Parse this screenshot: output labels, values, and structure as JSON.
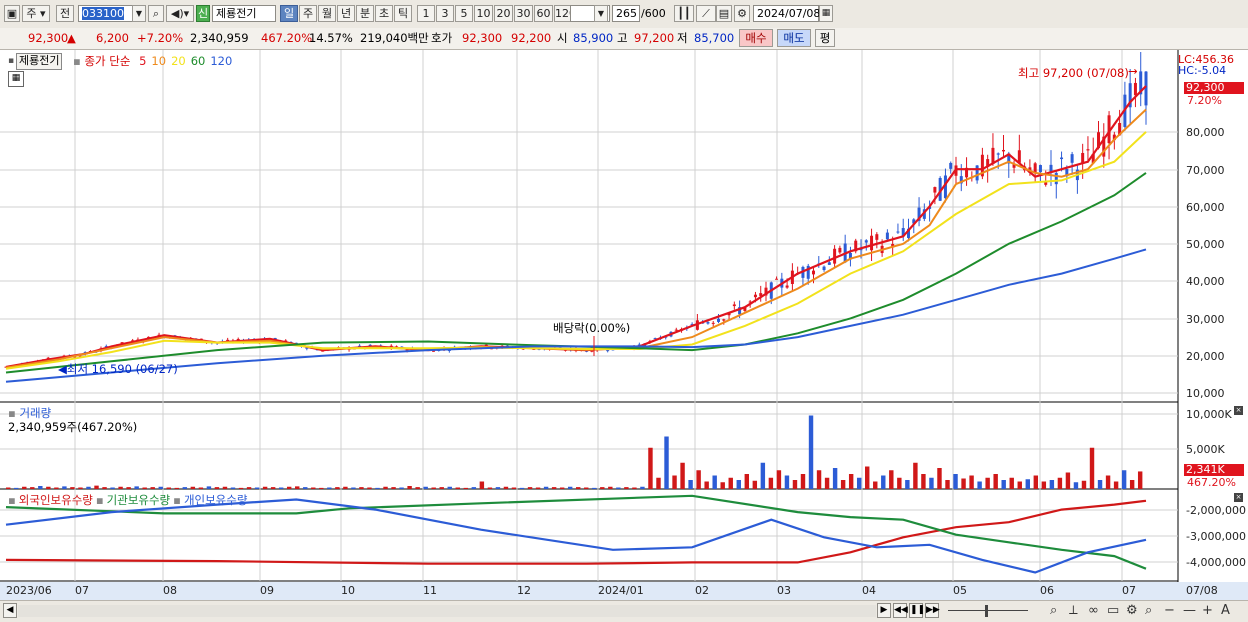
{
  "toolbar": {
    "market": "주",
    "prev": "전",
    "code": "033100",
    "new_badge": "신",
    "stock_name": "제룡전기",
    "periods": [
      "일",
      "주",
      "월",
      "년",
      "분",
      "초",
      "틱"
    ],
    "period_selected": "일",
    "intervals": [
      "1",
      "3",
      "5",
      "10",
      "20",
      "30",
      "60",
      "120"
    ],
    "count": "265",
    "count_total": "/600",
    "date": "2024/07/08"
  },
  "quote": {
    "price": "92,300",
    "change_arrow": "▲",
    "change": "6,200",
    "change_pct": "+7.20%",
    "volume": "2,340,959",
    "vol_ratio": "467.20%",
    "turnover": "14.57%",
    "amount": "219,040백만",
    "bid_label": "호가",
    "ask": "92,300",
    "bid": "92,200",
    "open_label": "시",
    "open": "85,900",
    "high_label": "고",
    "high": "97,200",
    "low_label": "저",
    "low": "85,700",
    "buy_label": "매수",
    "sell_label": "매도",
    "eval_label": "평"
  },
  "price_panel": {
    "name": "제룡전기",
    "legend_prefix": "종가 단순",
    "ma": [
      {
        "period": "5",
        "color": "#e0141e"
      },
      {
        "period": "10",
        "color": "#ee8a1c"
      },
      {
        "period": "20",
        "color": "#f2e21c"
      },
      {
        "period": "60",
        "color": "#1e8c2c"
      },
      {
        "period": "120",
        "color": "#2c5cd6"
      }
    ],
    "lc": "LC:456.36",
    "hc": "HC:-5.04",
    "current_price_tag": "92,300",
    "current_pct_tag": "7.20%",
    "high_annotation": "최고 97,200 (07/08)",
    "low_annotation": "최저 16,590 (06/27)",
    "event_annotation": "배당락(0.00%)",
    "yticks": [
      "80,000",
      "70,000",
      "60,000",
      "50,000",
      "40,000",
      "30,000",
      "20,000",
      "10,000"
    ]
  },
  "volume_panel": {
    "title": "거래량",
    "value": "2,340,959주(467.20%)",
    "yticks": [
      "10,000K",
      "5,000K"
    ],
    "last_tag": "2,341K",
    "last_pct_tag": "467.20%"
  },
  "holding_panel": {
    "series_names": [
      "외국인보유수량",
      "기관보유수량",
      "개인보유수량"
    ],
    "colors": [
      "#d01818",
      "#1e8c3c",
      "#2c5cd6"
    ],
    "yticks": [
      "-2,000,000",
      "-3,000,000",
      "-4,000,000"
    ]
  },
  "xaxis": {
    "labels": [
      "2023/06",
      "07",
      "08",
      "09",
      "10",
      "11",
      "12",
      "2024/01",
      "02",
      "03",
      "04",
      "05",
      "06",
      "07"
    ],
    "right_label": "07/08"
  },
  "chart_data": [
    {
      "type": "line",
      "title": "",
      "series": [
        {
          "name": "5",
          "points": [
            [
              0,
              17000
            ],
            [
              8,
              19000
            ],
            [
              15,
              20500
            ],
            [
              20,
              22500
            ],
            [
              30,
              25500
            ],
            [
              40,
              23500
            ],
            [
              50,
              24500
            ],
            [
              60,
              21500
            ],
            [
              70,
              22500
            ],
            [
              80,
              21500
            ],
            [
              90,
              22500
            ],
            [
              100,
              22000
            ],
            [
              110,
              21500
            ],
            [
              120,
              22500
            ],
            [
              130,
              28000
            ],
            [
              140,
              33000
            ],
            [
              150,
              42000
            ],
            [
              160,
              48000
            ],
            [
              170,
              52000
            ],
            [
              175,
              60000
            ],
            [
              180,
              70000
            ],
            [
              185,
              70000
            ],
            [
              190,
              74000
            ],
            [
              195,
              68000
            ],
            [
              200,
              70000
            ],
            [
              205,
              72000
            ],
            [
              210,
              82000
            ],
            [
              213,
              88000
            ],
            [
              216,
              92300
            ]
          ]
        },
        {
          "name": "10",
          "points": [
            [
              0,
              16800
            ],
            [
              10,
              19000
            ],
            [
              20,
              22000
            ],
            [
              30,
              25000
            ],
            [
              40,
              23500
            ],
            [
              50,
              24000
            ],
            [
              60,
              21800
            ],
            [
              70,
              22200
            ],
            [
              80,
              21800
            ],
            [
              90,
              22300
            ],
            [
              100,
              22000
            ],
            [
              110,
              21600
            ],
            [
              120,
              22000
            ],
            [
              130,
              25000
            ],
            [
              140,
              31500
            ],
            [
              150,
              38000
            ],
            [
              160,
              46000
            ],
            [
              170,
              50000
            ],
            [
              175,
              55000
            ],
            [
              180,
              66000
            ],
            [
              190,
              72000
            ],
            [
              195,
              69000
            ],
            [
              200,
              68000
            ],
            [
              205,
              70000
            ],
            [
              210,
              78000
            ],
            [
              216,
              86000
            ]
          ]
        },
        {
          "name": "20",
          "points": [
            [
              0,
              16500
            ],
            [
              10,
              18500
            ],
            [
              20,
              21000
            ],
            [
              30,
              24000
            ],
            [
              40,
              23500
            ],
            [
              50,
              23500
            ],
            [
              60,
              22000
            ],
            [
              70,
              22000
            ],
            [
              80,
              22000
            ],
            [
              90,
              22200
            ],
            [
              100,
              22000
            ],
            [
              110,
              21800
            ],
            [
              120,
              21800
            ],
            [
              130,
              23000
            ],
            [
              140,
              28000
            ],
            [
              150,
              34000
            ],
            [
              160,
              42000
            ],
            [
              170,
              48000
            ],
            [
              180,
              58000
            ],
            [
              190,
              66000
            ],
            [
              200,
              67000
            ],
            [
              210,
              72000
            ],
            [
              216,
              80000
            ]
          ]
        },
        {
          "name": "60",
          "points": [
            [
              0,
              15500
            ],
            [
              20,
              18500
            ],
            [
              40,
              21500
            ],
            [
              60,
              23500
            ],
            [
              80,
              23800
            ],
            [
              100,
              22800
            ],
            [
              120,
              22000
            ],
            [
              130,
              21500
            ],
            [
              140,
              23000
            ],
            [
              150,
              26000
            ],
            [
              160,
              30000
            ],
            [
              170,
              35000
            ],
            [
              180,
              42000
            ],
            [
              190,
              50000
            ],
            [
              200,
              56000
            ],
            [
              210,
              63000
            ],
            [
              216,
              69000
            ]
          ]
        },
        {
          "name": "120",
          "points": [
            [
              0,
              13000
            ],
            [
              20,
              15500
            ],
            [
              40,
              18000
            ],
            [
              60,
              20000
            ],
            [
              80,
              21500
            ],
            [
              100,
              22500
            ],
            [
              120,
              22500
            ],
            [
              130,
              22300
            ],
            [
              140,
              23000
            ],
            [
              150,
              25000
            ],
            [
              160,
              28000
            ],
            [
              170,
              31000
            ],
            [
              180,
              35000
            ],
            [
              190,
              39000
            ],
            [
              200,
              42000
            ],
            [
              210,
              46000
            ],
            [
              216,
              48500
            ]
          ]
        }
      ],
      "ylim": [
        10000,
        97200
      ]
    },
    {
      "type": "bar",
      "title": "거래량",
      "values_k": [
        200,
        150,
        300,
        250,
        400,
        300,
        200,
        350,
        250,
        200,
        300,
        450,
        250,
        200,
        300,
        250,
        350,
        200,
        250,
        300,
        200,
        150,
        250,
        300,
        200,
        350,
        250,
        300,
        200,
        150,
        250,
        200,
        300,
        250,
        200,
        300,
        350,
        250,
        200,
        150,
        200,
        250,
        300,
        200,
        250,
        200,
        150,
        300,
        250,
        200,
        400,
        250,
        300,
        200,
        250,
        300,
        200,
        150,
        250,
        1000,
        200,
        250,
        300,
        200,
        150,
        250,
        200,
        300,
        250,
        200,
        300,
        250,
        200,
        150,
        250,
        300,
        200,
        250,
        200,
        300,
        5500,
        1500,
        7000,
        1800,
        3500,
        1200,
        2500,
        1000,
        1800,
        900,
        1500,
        1200,
        2000,
        1100,
        3500,
        1500,
        2500,
        1800,
        1200,
        2000,
        9800,
        2500,
        1500,
        2800,
        1200,
        2000,
        1500,
        3000,
        1000,
        1800,
        2500,
        1500,
        1200,
        3500,
        2000,
        1500,
        2800,
        1200,
        2000,
        1400,
        1800,
        1000,
        1500,
        2000,
        1200,
        1500,
        1000,
        1300,
        1800,
        1000,
        1200,
        1500,
        2200,
        900,
        1100,
        5500,
        1200,
        1800,
        1000,
        2500,
        1200,
        2341
      ],
      "ylim": [
        0,
        10000
      ]
    },
    {
      "type": "line",
      "title": "",
      "series": [
        {
          "name": "외국인보유수량",
          "points": [
            [
              0,
              -4200000
            ],
            [
              40,
              -4250000
            ],
            [
              80,
              -4350000
            ],
            [
              110,
              -4350000
            ],
            [
              130,
              -4300000
            ],
            [
              150,
              -4300000
            ],
            [
              160,
              -3900000
            ],
            [
              170,
              -3300000
            ],
            [
              180,
              -2900000
            ],
            [
              190,
              -2700000
            ],
            [
              200,
              -2200000
            ],
            [
              210,
              -2000000
            ],
            [
              216,
              -1850000
            ]
          ]
        },
        {
          "name": "기관보유수량",
          "points": [
            [
              0,
              -2100000
            ],
            [
              30,
              -2350000
            ],
            [
              55,
              -2350000
            ],
            [
              65,
              -2150000
            ],
            [
              90,
              -1950000
            ],
            [
              130,
              -1650000
            ],
            [
              150,
              -2300000
            ],
            [
              160,
              -2500000
            ],
            [
              170,
              -2600000
            ],
            [
              180,
              -3200000
            ],
            [
              190,
              -3500000
            ],
            [
              200,
              -3800000
            ],
            [
              210,
              -4050000
            ],
            [
              216,
              -4550000
            ]
          ]
        },
        {
          "name": "개인보유수량",
          "points": [
            [
              0,
              -2800000
            ],
            [
              20,
              -2300000
            ],
            [
              40,
              -2000000
            ],
            [
              55,
              -1800000
            ],
            [
              70,
              -2200000
            ],
            [
              90,
              -3000000
            ],
            [
              115,
              -3800000
            ],
            [
              130,
              -3700000
            ],
            [
              145,
              -2600000
            ],
            [
              155,
              -3300000
            ],
            [
              165,
              -3700000
            ],
            [
              175,
              -3600000
            ],
            [
              185,
              -4200000
            ],
            [
              195,
              -4700000
            ],
            [
              205,
              -3900000
            ],
            [
              216,
              -3400000
            ]
          ]
        }
      ],
      "ylim": [
        -5000000,
        -1500000
      ]
    }
  ]
}
